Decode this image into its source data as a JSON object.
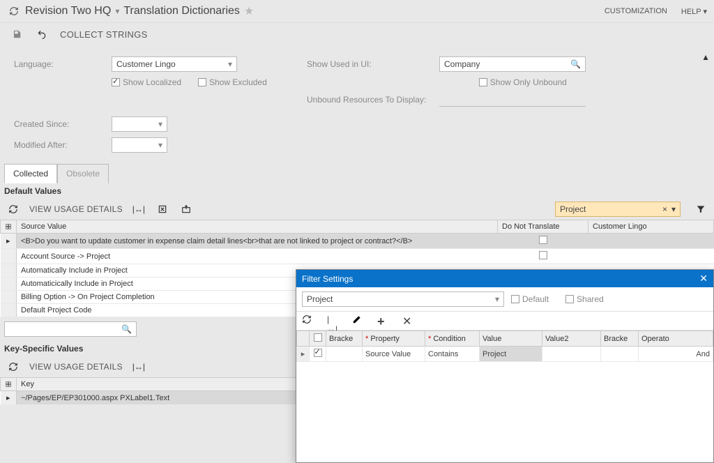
{
  "header": {
    "company": "Revision Two HQ",
    "page_title": "Translation Dictionaries",
    "customization": "CUSTOMIZATION",
    "help": "HELP"
  },
  "toolbar": {
    "collect_strings": "COLLECT STRINGS"
  },
  "form": {
    "language_label": "Language:",
    "language_value": "Customer Lingo",
    "show_localized": "Show Localized",
    "show_excluded": "Show Excluded",
    "show_used_label": "Show Used in UI:",
    "show_used_value": "Company",
    "show_only_unbound": "Show Only Unbound",
    "unbound_label": "Unbound Resources To Display:",
    "unbound_value": "",
    "created_since_label": "Created Since:",
    "created_since_value": "",
    "modified_after_label": "Modified After:",
    "modified_after_value": ""
  },
  "tabs": {
    "collected": "Collected",
    "obsolete": "Obsolete"
  },
  "grid1": {
    "title": "Default Values",
    "view_usage": "VIEW USAGE DETAILS",
    "filter_value": "Project",
    "cols": {
      "source": "Source Value",
      "dnt": "Do Not Translate",
      "cl": "Customer Lingo"
    },
    "rows": [
      "<B>Do you want to update customer in expense claim detail lines<br>that are not linked to project or contract?</B>",
      "Account Source -> Project",
      "Automatically Include in Project",
      "Automaticically Include in Project",
      "Billing Option -> On Project Completion",
      "Default Project Code"
    ]
  },
  "grid2": {
    "title": "Key-Specific Values",
    "view_usage": "VIEW USAGE DETAILS",
    "col_key": "Key",
    "rows": [
      "~/Pages/EP/EP301000.aspx PXLabel1.Text"
    ]
  },
  "dialog": {
    "title": "Filter Settings",
    "combo_value": "Project",
    "default_label": "Default",
    "shared_label": "Shared",
    "cols": {
      "bracket_open": "Bracke",
      "property": "Property",
      "condition": "Condition",
      "value": "Value",
      "value2": "Value2",
      "bracket_close": "Bracke",
      "operator": "Operato"
    },
    "row": {
      "property": "Source Value",
      "condition": "Contains",
      "value": "Project",
      "operator": "And"
    }
  }
}
